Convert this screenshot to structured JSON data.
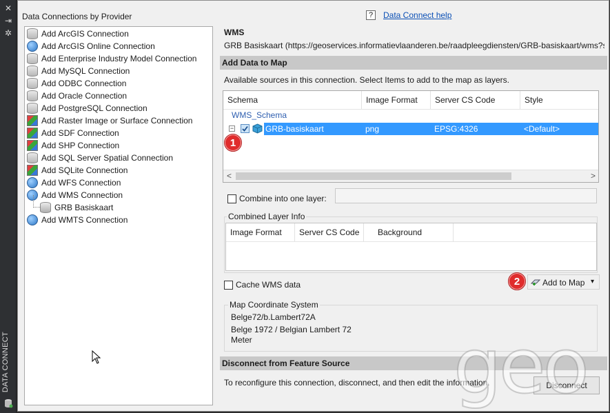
{
  "side_strip": {
    "title": "DATA CONNECT",
    "icons": [
      "close-icon",
      "pin-icon",
      "settings-icon",
      "database-icon"
    ]
  },
  "left_panel": {
    "heading": "Data Connections by Provider",
    "items": [
      {
        "label": "Add ArcGIS Connection",
        "icon": "database-icon"
      },
      {
        "label": "Add ArcGIS Online Connection",
        "icon": "globe-icon"
      },
      {
        "label": "Add Enterprise Industry Model Connection",
        "icon": "database-icon"
      },
      {
        "label": "Add MySQL Connection",
        "icon": "database-icon"
      },
      {
        "label": "Add ODBC Connection",
        "icon": "database-icon"
      },
      {
        "label": "Add Oracle Connection",
        "icon": "database-icon"
      },
      {
        "label": "Add PostgreSQL Connection",
        "icon": "database-icon"
      },
      {
        "label": "Add Raster Image or Surface Connection",
        "icon": "raster-icon"
      },
      {
        "label": "Add SDF Connection",
        "icon": "raster-icon"
      },
      {
        "label": "Add SHP Connection",
        "icon": "raster-icon"
      },
      {
        "label": "Add SQL Server Spatial Connection",
        "icon": "database-icon"
      },
      {
        "label": "Add SQLite Connection",
        "icon": "raster-icon"
      },
      {
        "label": "Add WFS Connection",
        "icon": "globe-icon"
      },
      {
        "label": "Add WMS Connection",
        "icon": "globe-icon"
      },
      {
        "label": "GRB Basiskaart",
        "icon": "database-icon",
        "child": true
      },
      {
        "label": "Add WMTS Connection",
        "icon": "globe-icon"
      }
    ]
  },
  "help": {
    "icon": "help-icon",
    "label": "Data Connect help",
    "glyph": "?"
  },
  "connection": {
    "type": "WMS",
    "description": "GRB Basiskaart (https://geoservices.informatievlaanderen.be/raadpleegdiensten/GRB-basiskaart/wms?service"
  },
  "add_data": {
    "section_title": "Add Data to Map",
    "instructions": "Available sources in this connection.  Select Items to add to the map as layers.",
    "columns": [
      "Schema",
      "Image Format",
      "Server CS Code",
      "Style"
    ],
    "schema_name": "WMS_Schema",
    "row": {
      "name": "GRB-basiskaart",
      "format": "png",
      "cs_code": "EPSG:4326",
      "style": "<Default>",
      "checked": true
    },
    "scroll_left": "<",
    "scroll_right": ">",
    "combine_label": "Combine into one layer:",
    "combined_info_title": "Combined Layer Info",
    "combined_columns": [
      "Image Format",
      "Server CS Code",
      "Background"
    ],
    "cache_label": "Cache WMS data",
    "add_button": "Add to Map",
    "dropdown_glyph": "▾",
    "callout_1": "1",
    "callout_2": "2"
  },
  "coordinate_system": {
    "title": "Map Coordinate System",
    "code": "Belge72/b.Lambert72A",
    "name": "Belge 1972 / Belgian Lambert 72",
    "units": "Meter"
  },
  "disconnect": {
    "section_title": "Disconnect from Feature Source",
    "text": "To reconfigure this connection, disconnect, and then edit the information.",
    "button": "Disconnect"
  },
  "watermark": "geo",
  "colors": {
    "selection": "#3399ff",
    "section_bar": "#c8c8c8",
    "link": "#0a4fb5",
    "callout": "#e02c2c"
  }
}
